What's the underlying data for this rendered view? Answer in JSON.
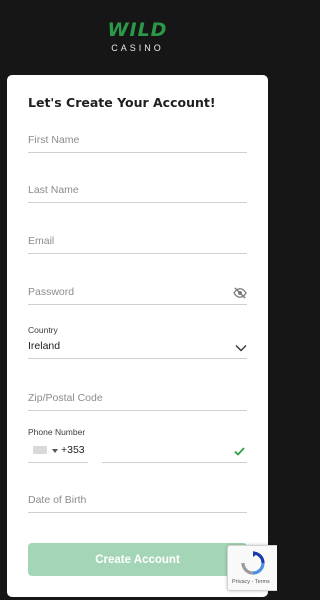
{
  "brand": {
    "top": "WILD",
    "bottom": "CASINO"
  },
  "form": {
    "title": "Let's Create Your Account!",
    "first_name_placeholder": "First Name",
    "last_name_placeholder": "Last Name",
    "email_placeholder": "Email",
    "password_placeholder": "Password",
    "country_label": "Country",
    "country_value": "Ireland",
    "zip_placeholder": "Zip/Postal Code",
    "phone_label": "Phone Number",
    "dial_code": "+353",
    "dob_placeholder": "Date of Birth",
    "submit_label": "Create Account"
  },
  "recaptcha": {
    "links": "Privacy - Terms"
  },
  "colors": {
    "page_bg": "#161616",
    "brand_green": "#2a9a48",
    "button_bg": "#a5d5b7",
    "valid_check": "#2f9e44"
  },
  "icons": [
    "eye-slash-icon",
    "chevron-down-icon",
    "check-icon",
    "recaptcha-icon",
    "flag-icon"
  ]
}
